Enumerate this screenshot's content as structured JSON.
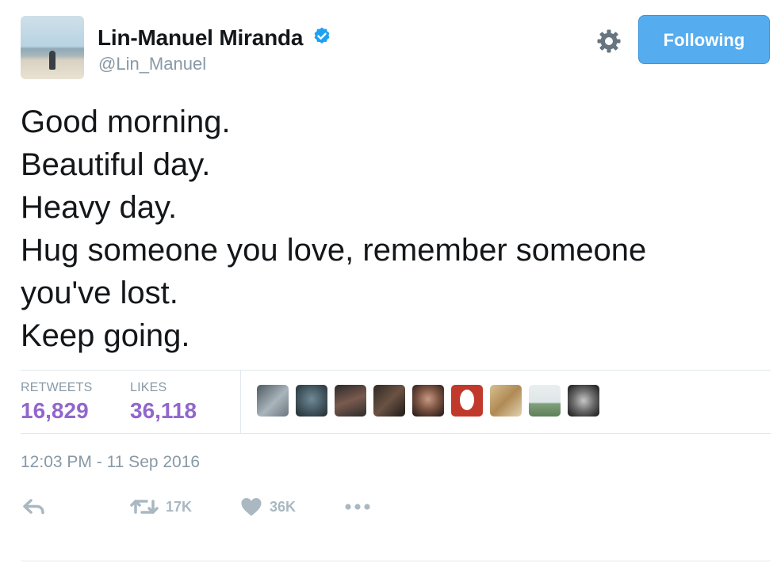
{
  "author": {
    "name": "Lin-Manuel Miranda",
    "handle": "@Lin_Manuel",
    "verified": true
  },
  "header": {
    "follow_label": "Following",
    "settings_icon": "gear-icon"
  },
  "tweet": {
    "lines": [
      "Good morning.",
      "Beautiful day.",
      "Heavy day.",
      "Hug someone you love, remember someone",
      "you've lost.",
      "Keep going."
    ]
  },
  "stats": {
    "retweets_label": "RETWEETS",
    "retweets_count": "16,829",
    "likes_label": "LIKES",
    "likes_count": "36,118"
  },
  "timestamp": "12:03 PM - 11 Sep 2016",
  "actions": {
    "reply_icon": "reply-icon",
    "retweet_icon": "retweet-icon",
    "retweet_count": "17K",
    "like_icon": "heart-icon",
    "like_count": "36K",
    "more_icon": "more-icon"
  },
  "colors": {
    "follow_blue": "#55acee",
    "count_purple": "#9266cc",
    "verified_blue": "#1da1f2",
    "muted_gray": "#8899a6"
  }
}
